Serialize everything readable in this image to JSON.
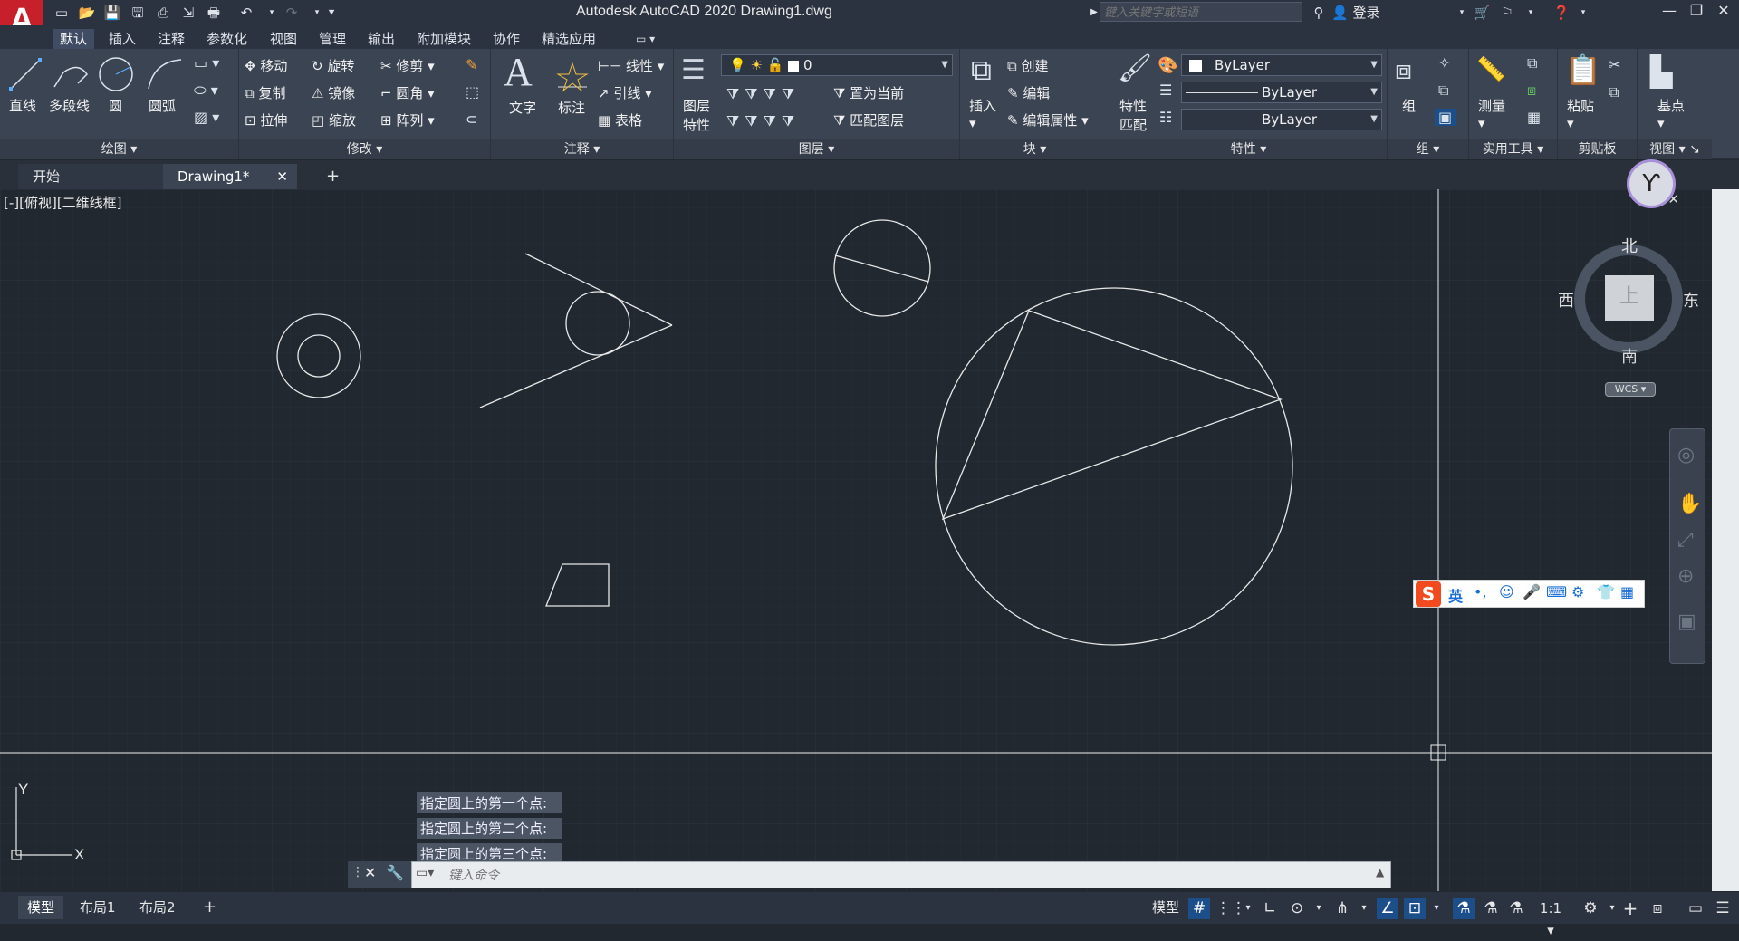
{
  "app": {
    "logo": "A",
    "title": "Autodesk AutoCAD 2020    Drawing1.dwg"
  },
  "search": {
    "placeholder": "键入关键字或短语"
  },
  "account": {
    "login": "登录"
  },
  "ribbon_tabs": [
    "默认",
    "插入",
    "注释",
    "参数化",
    "视图",
    "管理",
    "输出",
    "附加模块",
    "协作",
    "精选应用"
  ],
  "panels": {
    "draw": {
      "title": "绘图",
      "line": "直线",
      "polyline": "多段线",
      "circle": "圆",
      "arc": "圆弧"
    },
    "modify": {
      "title": "修改",
      "move": "移动",
      "rotate": "旋转",
      "trim": "修剪",
      "copy": "复制",
      "mirror": "镜像",
      "fillet": "圆角",
      "stretch": "拉伸",
      "scale": "缩放",
      "array": "阵列"
    },
    "annotation": {
      "title": "注释",
      "text": "文字",
      "dimension": "标注",
      "linear": "线性",
      "leader": "引线",
      "table": "表格"
    },
    "layers": {
      "title": "图层",
      "props_l1": "图层",
      "props_l2": "特性",
      "layer_value": "0",
      "set_current": "置为当前",
      "match_layer": "匹配图层"
    },
    "block": {
      "title": "块",
      "insert": "插入",
      "create": "创建",
      "edit": "编辑",
      "edit_attr": "编辑属性"
    },
    "properties": {
      "title": "特性",
      "match_l1": "特性",
      "match_l2": "匹配",
      "color": "ByLayer",
      "linetype": "ByLayer",
      "lineweight": "ByLayer"
    },
    "groups": {
      "title": "组",
      "group": "组"
    },
    "utilities": {
      "title": "实用工具",
      "measure": "测量"
    },
    "clipboard": {
      "title": "剪贴板",
      "paste": "粘贴"
    },
    "view": {
      "title": "视图",
      "base": "基点"
    }
  },
  "doc_tabs": {
    "start": "开始",
    "drawing": "Drawing1*"
  },
  "viewport": {
    "label": "[-][俯视][二维线框]"
  },
  "viewcube": {
    "north": "北",
    "south": "南",
    "east": "东",
    "west": "西",
    "face": "上",
    "wcs": "WCS"
  },
  "ucs": {
    "x": "X",
    "y": "Y"
  },
  "command": {
    "history": [
      "指定圆上的第一个点:",
      "指定圆上的第二个点:",
      "指定圆上的第三个点:"
    ],
    "placeholder": "键入命令"
  },
  "ime": {
    "lang": "英"
  },
  "layout_tabs": [
    "模型",
    "布局1",
    "布局2"
  ],
  "status": {
    "model": "模型",
    "scale": "1:1"
  },
  "colors": {
    "canvas": "#212830",
    "ribbon": "#3b4453",
    "accent": "#1c4f8a",
    "logo": "#c8202a"
  }
}
